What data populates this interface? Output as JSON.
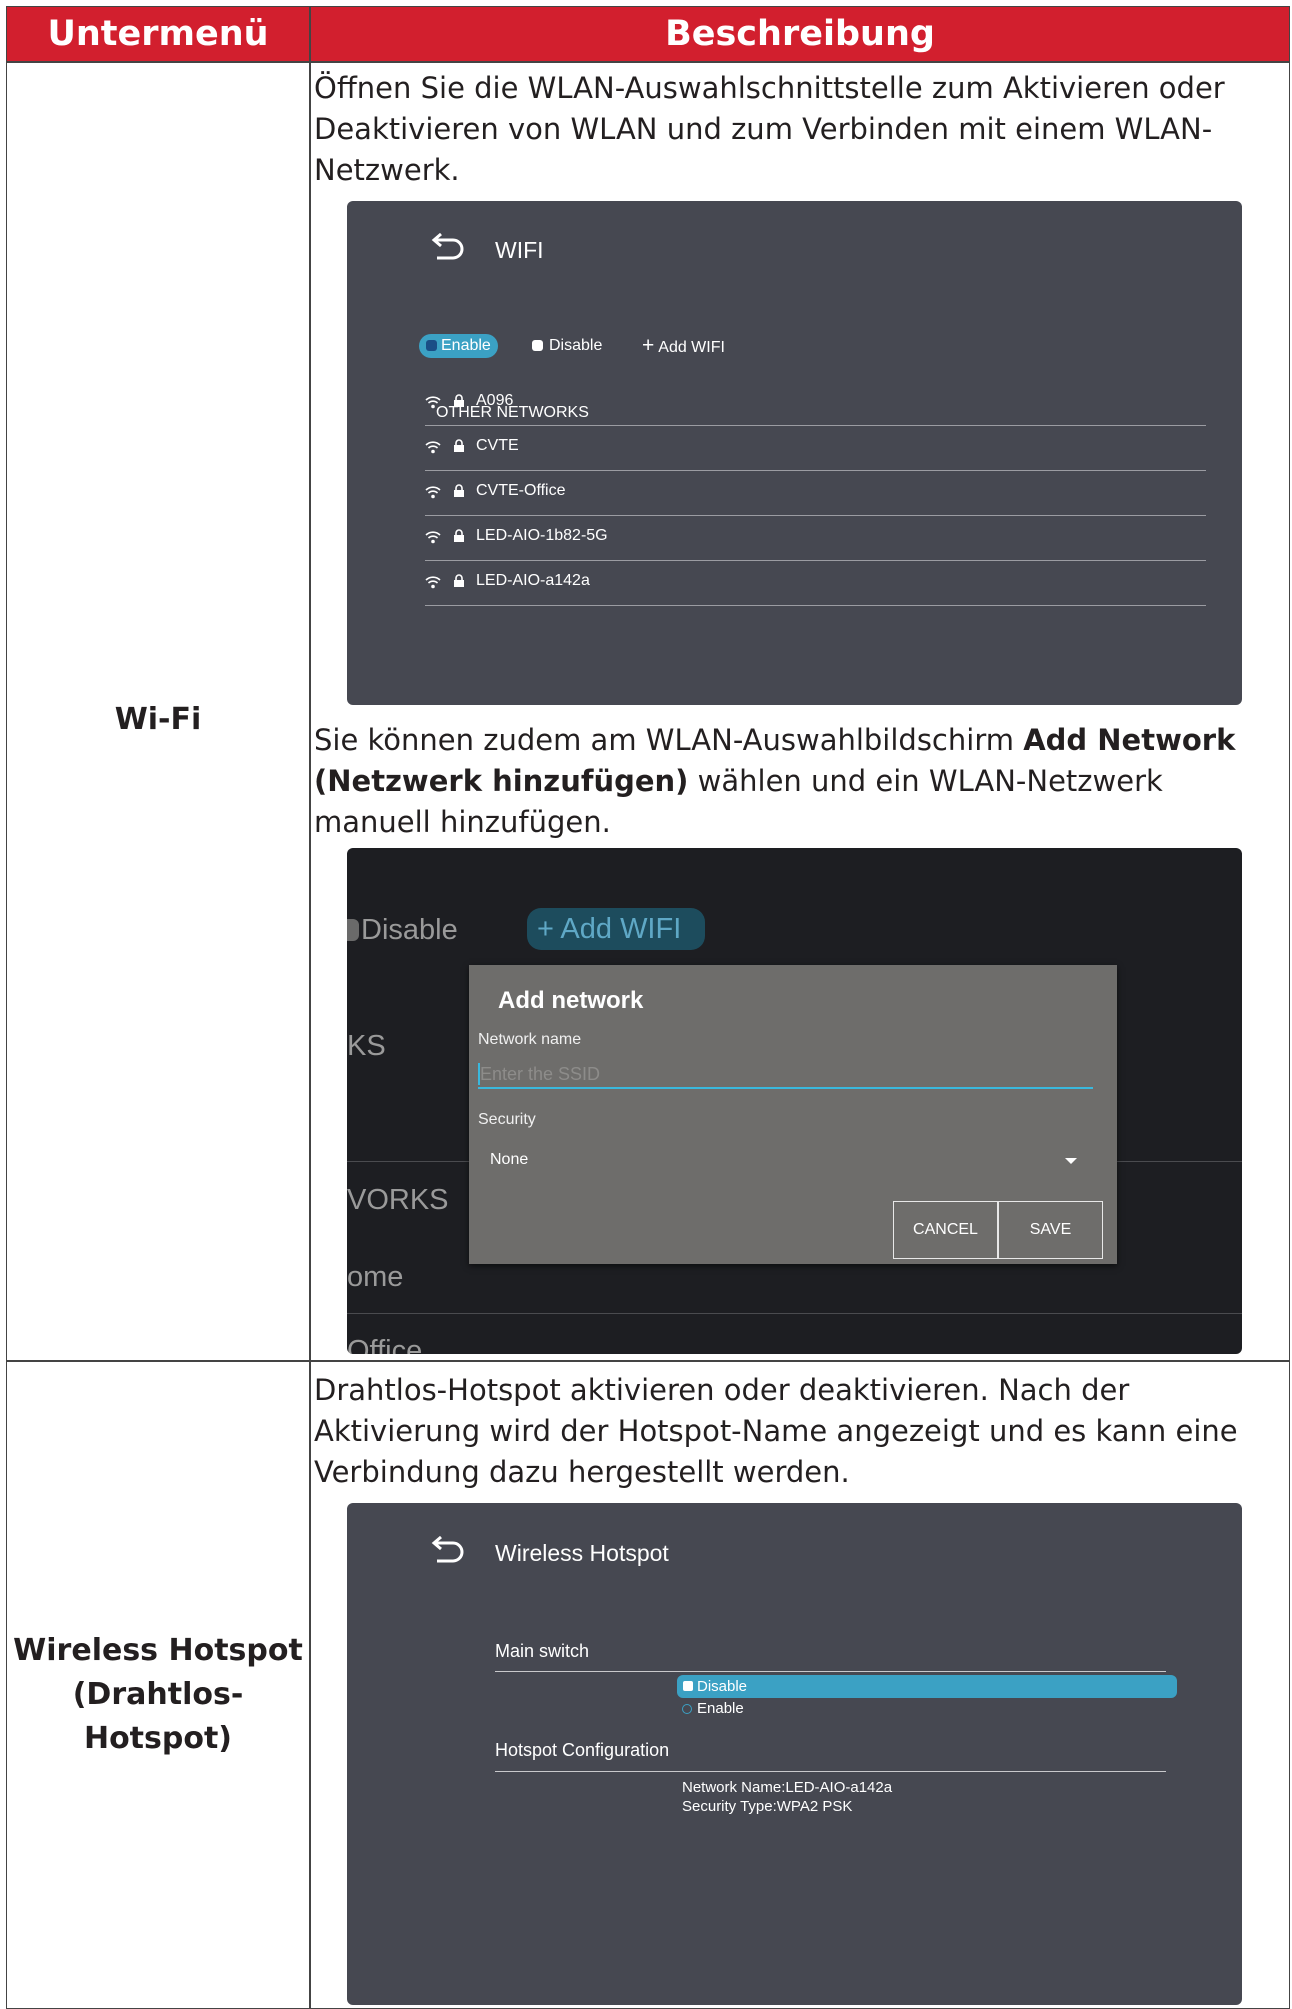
{
  "header": {
    "col1": "Untermenü",
    "col2": "Beschreibung"
  },
  "rows": [
    {
      "label": "Wi-Fi",
      "para1": "Öffnen Sie die WLAN-Auswahlschnittstelle zum Aktivieren oder Deaktivieren von WLAN und zum Verbinden mit einem WLAN-Netzwerk.",
      "para2_pre": "Sie können zudem am WLAN-Auswahlbildschirm ",
      "para2_bold": "Add Network (Netzwerk hinzufügen)",
      "para2_post": " wählen und ein WLAN-Netzwerk manuell hinzufügen.",
      "wifi_screen": {
        "title": "WIFI",
        "enable_label": "Enable",
        "disable_label": "Disable",
        "add_wifi_label": "Add WIFI",
        "other_networks_label": "OTHER NETWORKS",
        "networks": [
          "A096",
          "CVTE",
          "CVTE-Office",
          "LED-AIO-1b82-5G",
          "LED-AIO-a142a"
        ]
      },
      "add_network_screen": {
        "bg_disable": "Disable",
        "bg_add_wifi": "Add WIFI",
        "bg_ks": "KS",
        "bg_works": "VORKS",
        "bg_home": "ome",
        "bg_office": "Office",
        "dialog_title": "Add network",
        "network_name_label": "Network name",
        "ssid_placeholder": "Enter the SSID",
        "security_label": "Security",
        "security_value": "None",
        "cancel_label": "CANCEL",
        "save_label": "SAVE"
      }
    },
    {
      "label": "Wireless Hotspot (Drahtlos-Hotspot)",
      "label_lines": [
        "Wireless Hotspot",
        "(Drahtlos-",
        "Hotspot)"
      ],
      "para1": "Drahtlos-Hotspot aktivieren oder deaktivieren. Nach der Aktivierung wird der Hotspot-Name angezeigt und es kann eine Verbindung dazu hergestellt werden.",
      "hotspot_screen": {
        "title": "Wireless Hotspot",
        "main_switch_label": "Main switch",
        "disable_label": "Disable",
        "enable_label": "Enable",
        "config_label": "Hotspot Configuration",
        "network_name": "Network Name:LED-AIO-a142a",
        "security_type": "Security Type:WPA2 PSK"
      }
    }
  ],
  "colors": {
    "header_red": "#d21f2e",
    "screen_bg": "#464851",
    "accent_blue": "#3ba1c4"
  }
}
